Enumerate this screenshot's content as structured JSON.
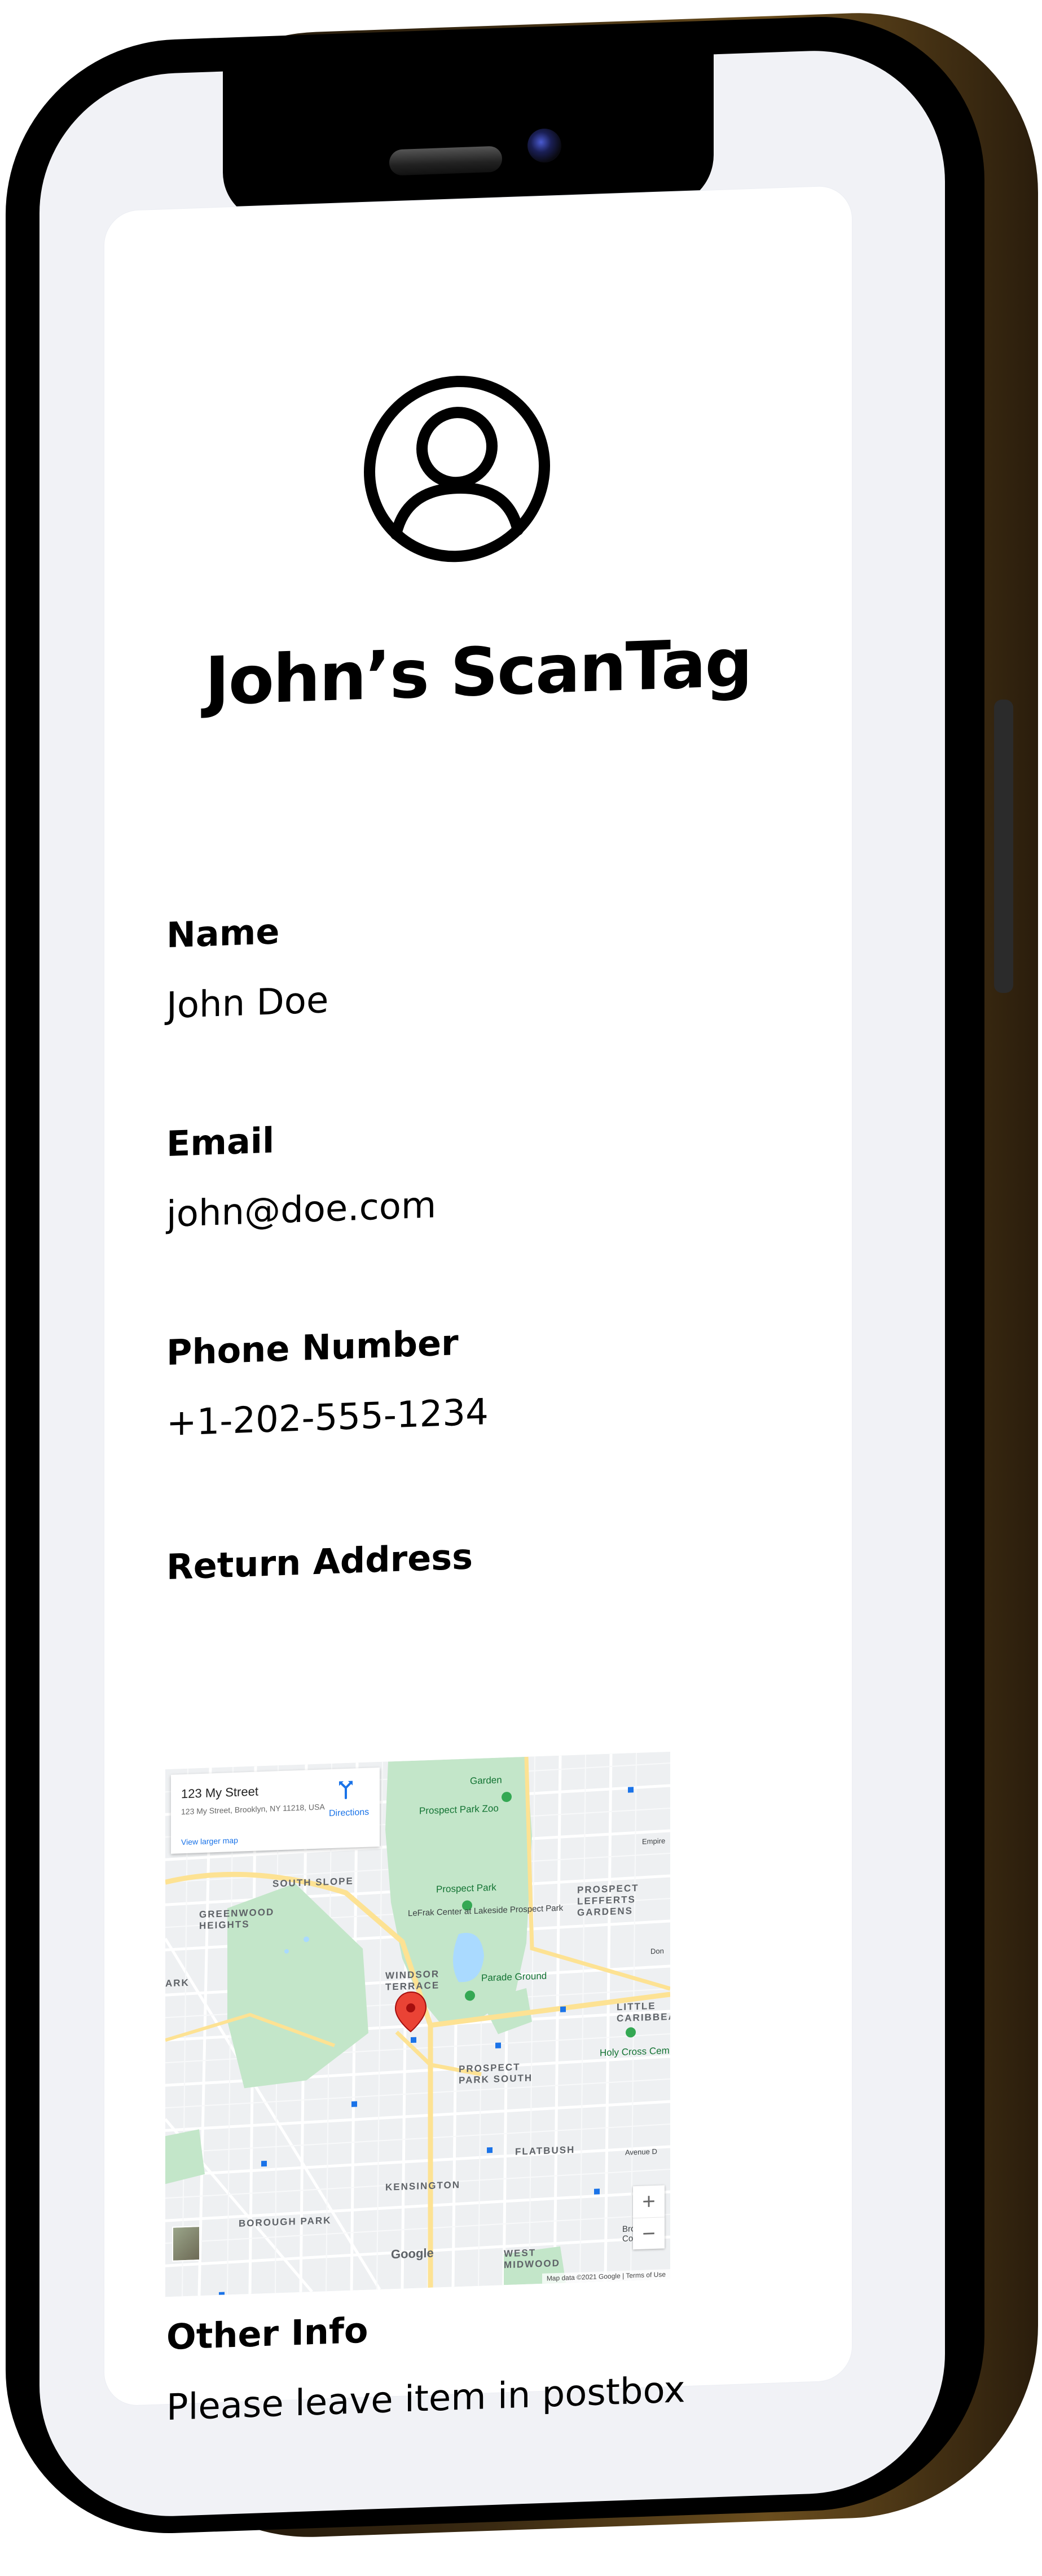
{
  "card": {
    "title": "John’s ScanTag",
    "fields": [
      {
        "label": "Name",
        "value": "John Doe"
      },
      {
        "label": "Email",
        "value": "john@doe.com"
      },
      {
        "label": "Phone Number",
        "value": "+1-202-555-1234"
      }
    ],
    "return_address_label": "Return Address",
    "other_info_label": "Other Info",
    "other_info_value": "Please leave item in postbox"
  },
  "map": {
    "info_title": "123 My Street",
    "info_address": "123 My Street, Brooklyn, NY 11218, USA",
    "directions_label": "Directions",
    "larger_map_label": "View larger map",
    "labels": {
      "prospect_park_zoo": "Prospect Park Zoo",
      "prospect_park": "Prospect Park",
      "lefrak_center": "LeFrak Center at Lakeside Prospect Park",
      "parade_ground": "Parade Ground",
      "south_slope": "SOUTH SLOPE",
      "greenwood_heights": "GREENWOOD HEIGHTS",
      "windsor_terrace": "WINDSOR TERRACE",
      "prospect_park_south": "PROSPECT PARK SOUTH",
      "prospect_lefferts": "PROSPECT LEFFERTS GARDENS",
      "little_caribbean": "LITTLE CARIBBEAN",
      "holy_cross": "Holy Cross Cem",
      "flatbush": "FLATBUSH",
      "kensington": "KENSINGTON",
      "borough_park": "BOROUGH PARK",
      "west_midwood": "WEST MIDWOOD",
      "brooklyn_college": "Brooklyn College",
      "garden": "Garden",
      "ark": "ARK",
      "empire": "Empire",
      "don": "Don",
      "avenue_d": "Avenue D"
    },
    "zoom_in": "+",
    "zoom_out": "−",
    "google": "Google",
    "footer": "Map data ©2021 Google | Terms of Use"
  },
  "colors": {
    "map_base": "#eef0f2",
    "park": "#c3e6c9",
    "water": "#aadaff",
    "highway": "#fde293",
    "pin": "#ea4335",
    "link": "#1a73e8"
  },
  "icons": {
    "avatar": "user-circle-icon",
    "directions": "directions-icon",
    "pin": "map-pin-icon"
  }
}
